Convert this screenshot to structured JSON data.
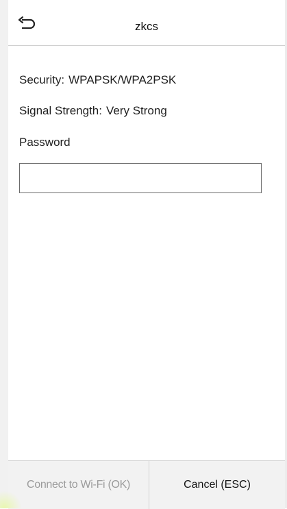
{
  "header": {
    "title": "zkcs",
    "back_icon": "back-arrow-icon"
  },
  "info": {
    "security_label": "Security:",
    "security_value": "WPAPSK/WPA2PSK",
    "signal_label": "Signal Strength:",
    "signal_value": "Very Strong",
    "password_label": "Password"
  },
  "password_field": {
    "value": "",
    "placeholder": ""
  },
  "footer": {
    "connect_label": "Connect to Wi-Fi (OK)",
    "cancel_label": "Cancel (ESC)"
  },
  "colors": {
    "border": "#cfcfcf",
    "footer_bg": "#f2f2f2",
    "disabled_text": "#9b9b9b"
  }
}
